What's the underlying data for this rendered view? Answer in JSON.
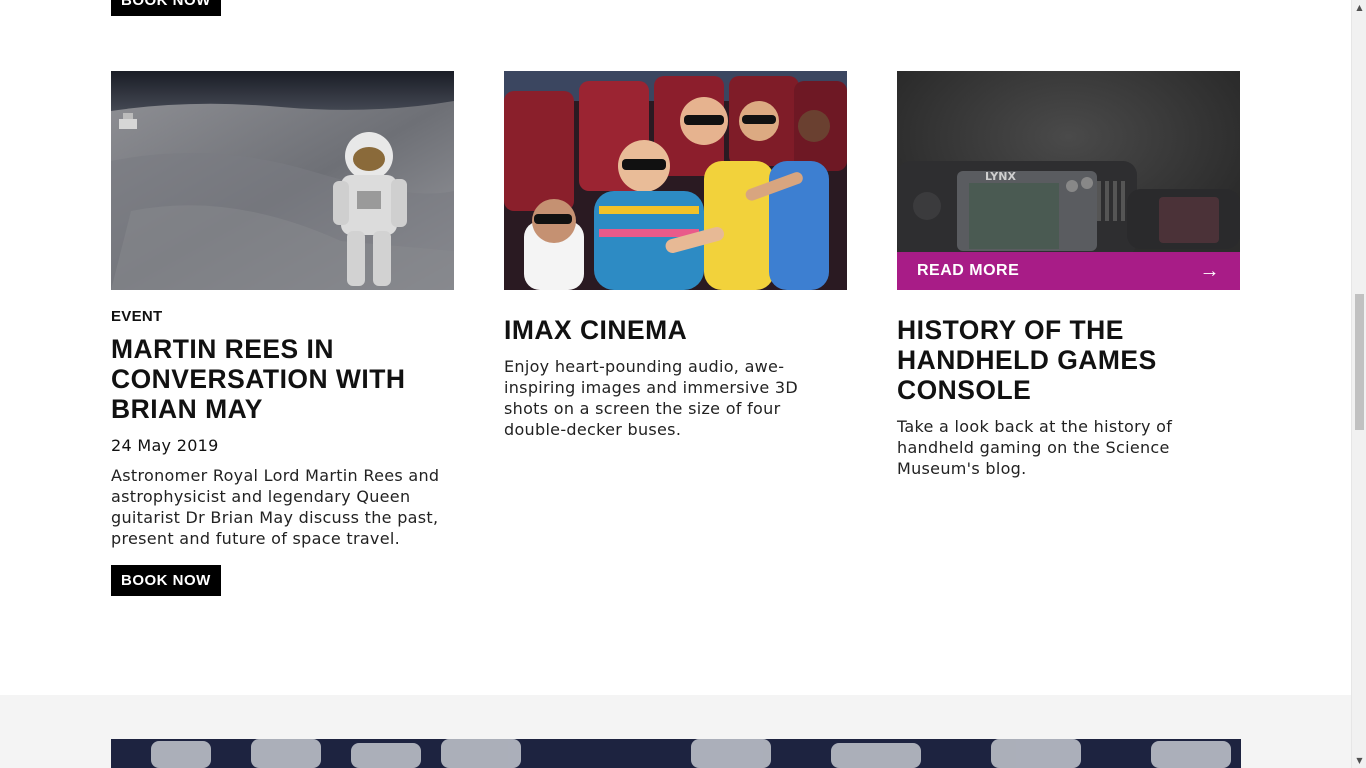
{
  "top_partial": {
    "book_label": "BOOK NOW"
  },
  "cards": [
    {
      "eyebrow": "EVENT",
      "title": "MARTIN REES IN CONVERSATION WITH BRIAN MAY",
      "date": "24 May 2019",
      "description": "Astronomer Royal Lord Martin Rees and astrophysicist and legendary Queen guitarist Dr Brian May discuss the past, present and future of space travel.",
      "button_label": "BOOK NOW",
      "image_icon": "astronaut-moon-image"
    },
    {
      "title": "IMAX CINEMA",
      "description": "Enjoy heart-pounding audio, awe-inspiring images and immersive 3D shots on a screen the size of four double-decker buses.",
      "image_icon": "children-3d-glasses-image"
    },
    {
      "title": "HISTORY OF THE HANDHELD GAMES CONSOLE",
      "description": "Take a look back at the history of handheld gaming on the Science Museum's blog.",
      "read_more_label": "READ MORE",
      "read_more_arrow": "→",
      "image_icon": "handheld-consoles-image",
      "console_logo": "LYNX"
    }
  ],
  "colors": {
    "accent": "#a81c87",
    "button_bg": "#000000",
    "band_bg": "#f4f4f4"
  },
  "scrollbar": {
    "up": "▲",
    "down": "▼"
  }
}
